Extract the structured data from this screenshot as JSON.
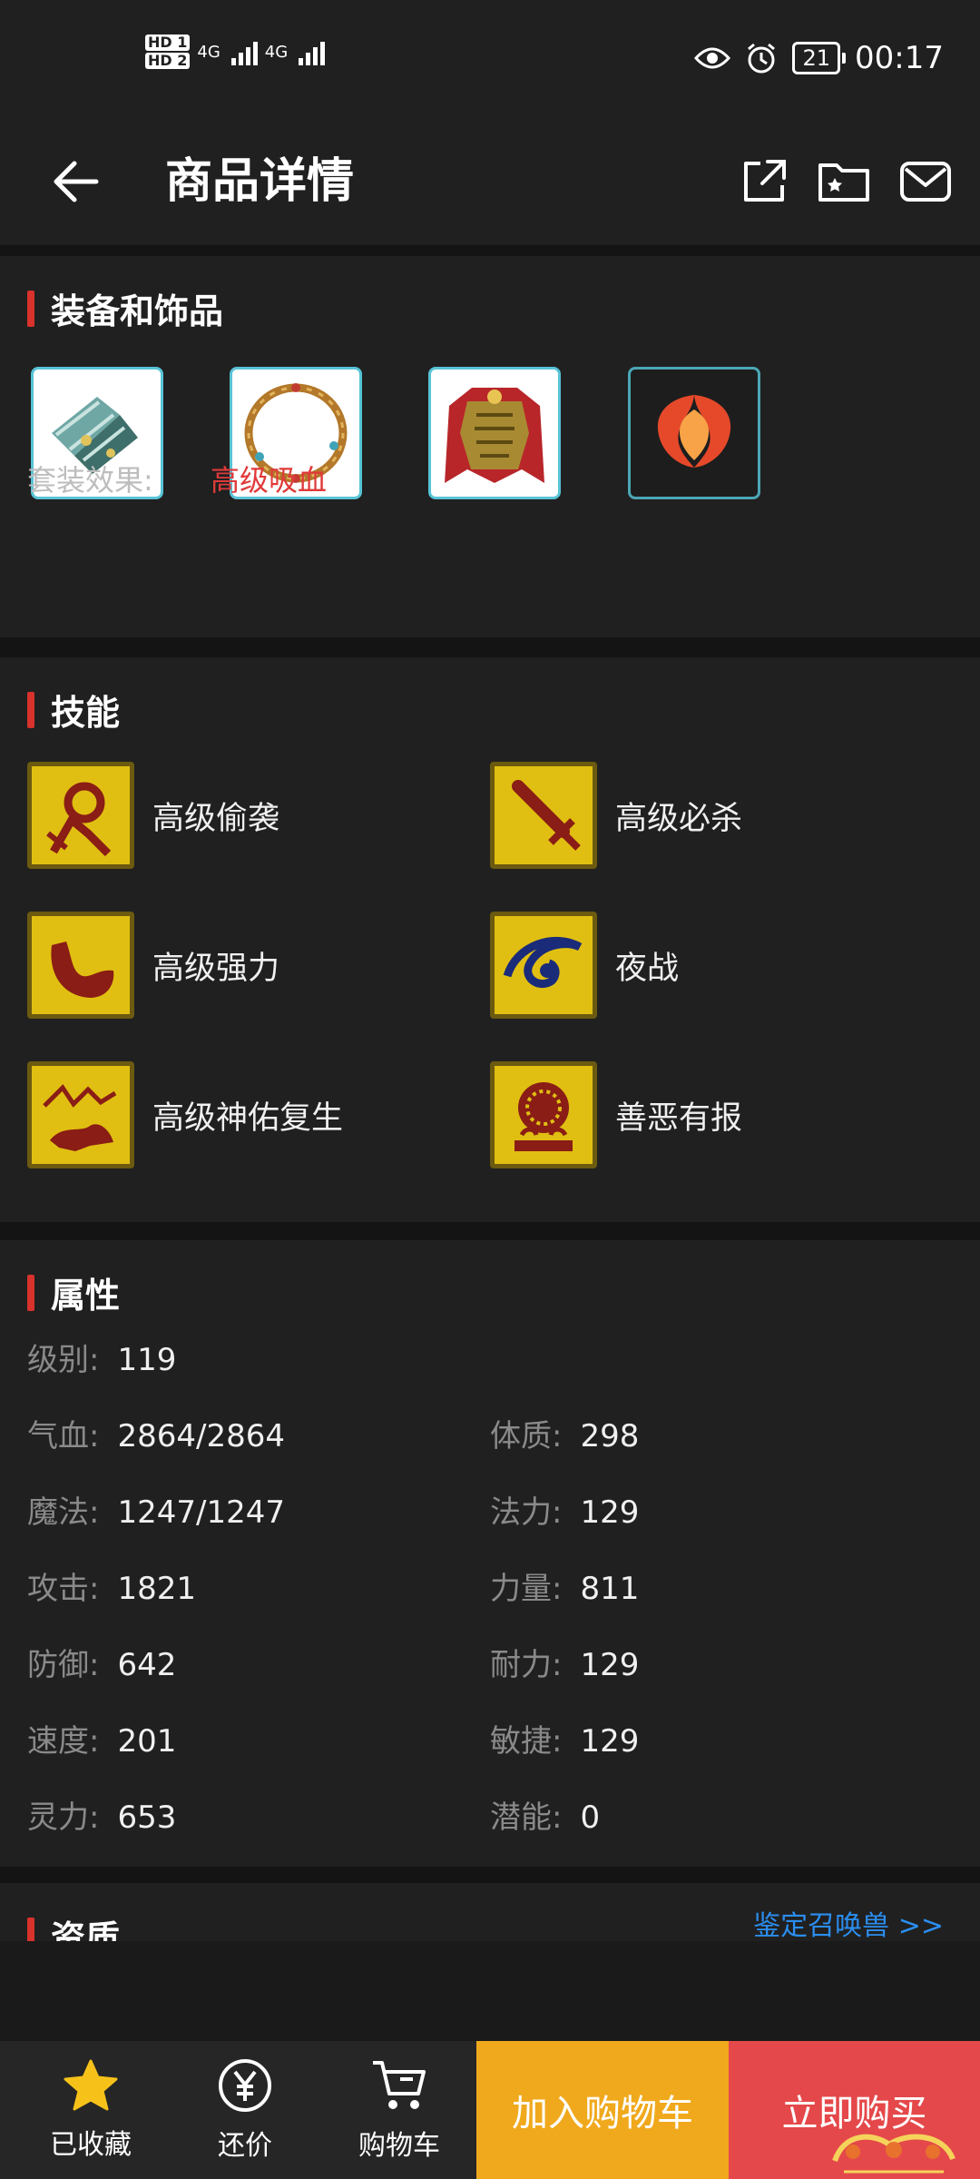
{
  "status_bar": {
    "hd1": "HD 1",
    "hd2": "HD 2",
    "net1": "4G",
    "net2": "4G",
    "battery": "21",
    "time": "00:17"
  },
  "header": {
    "title": "商品详情",
    "icons": [
      "back-arrow-icon",
      "share-icon",
      "favorite-folder-icon",
      "mail-icon"
    ]
  },
  "equipment": {
    "title": "装备和饰品",
    "items": [
      "bracers-icon",
      "necklace-icon",
      "armor-icon",
      "flame-emblem-icon"
    ],
    "set_label": "套装效果:",
    "set_value": "高级吸血"
  },
  "skills": {
    "title": "技能",
    "items": [
      {
        "name": "高级偷袭",
        "icon": "sneak-attack-icon"
      },
      {
        "name": "高级必杀",
        "icon": "sword-icon"
      },
      {
        "name": "高级强力",
        "icon": "strength-arm-icon"
      },
      {
        "name": "夜战",
        "icon": "eye-icon"
      },
      {
        "name": "高级神佑复生",
        "icon": "revive-icon"
      },
      {
        "name": "善恶有报",
        "icon": "karma-icon"
      }
    ]
  },
  "attributes": {
    "title": "属性",
    "level": {
      "label": "级别:",
      "value": "119"
    },
    "rows": [
      {
        "left_label": "气血:",
        "left_value": "2864/2864",
        "right_label": "体质:",
        "right_value": "298"
      },
      {
        "left_label": "魔法:",
        "left_value": "1247/1247",
        "right_label": "法力:",
        "right_value": "129"
      },
      {
        "left_label": "攻击:",
        "left_value": "1821",
        "right_label": "力量:",
        "right_value": "811"
      },
      {
        "left_label": "防御:",
        "left_value": "642",
        "right_label": "耐力:",
        "right_value": "129"
      },
      {
        "left_label": "速度:",
        "left_value": "201",
        "right_label": "敏捷:",
        "right_value": "129"
      },
      {
        "left_label": "灵力:",
        "left_value": "653",
        "right_label": "潜能:",
        "right_value": "0"
      }
    ]
  },
  "aptitude": {
    "title": "资质",
    "link": "鉴定召唤兽 >>"
  },
  "bottom_bar": {
    "favorite": "已收藏",
    "bargain": "还价",
    "cart": "购物车",
    "add_to_cart": "加入购物车",
    "buy_now": "立即购买"
  },
  "colors": {
    "accent_red": "#d8322c",
    "add_cart_bg": "#f0a91c",
    "buy_now_bg": "#e5484a",
    "favorite_star": "#f6c21a",
    "link_blue": "#2b8ef0"
  }
}
